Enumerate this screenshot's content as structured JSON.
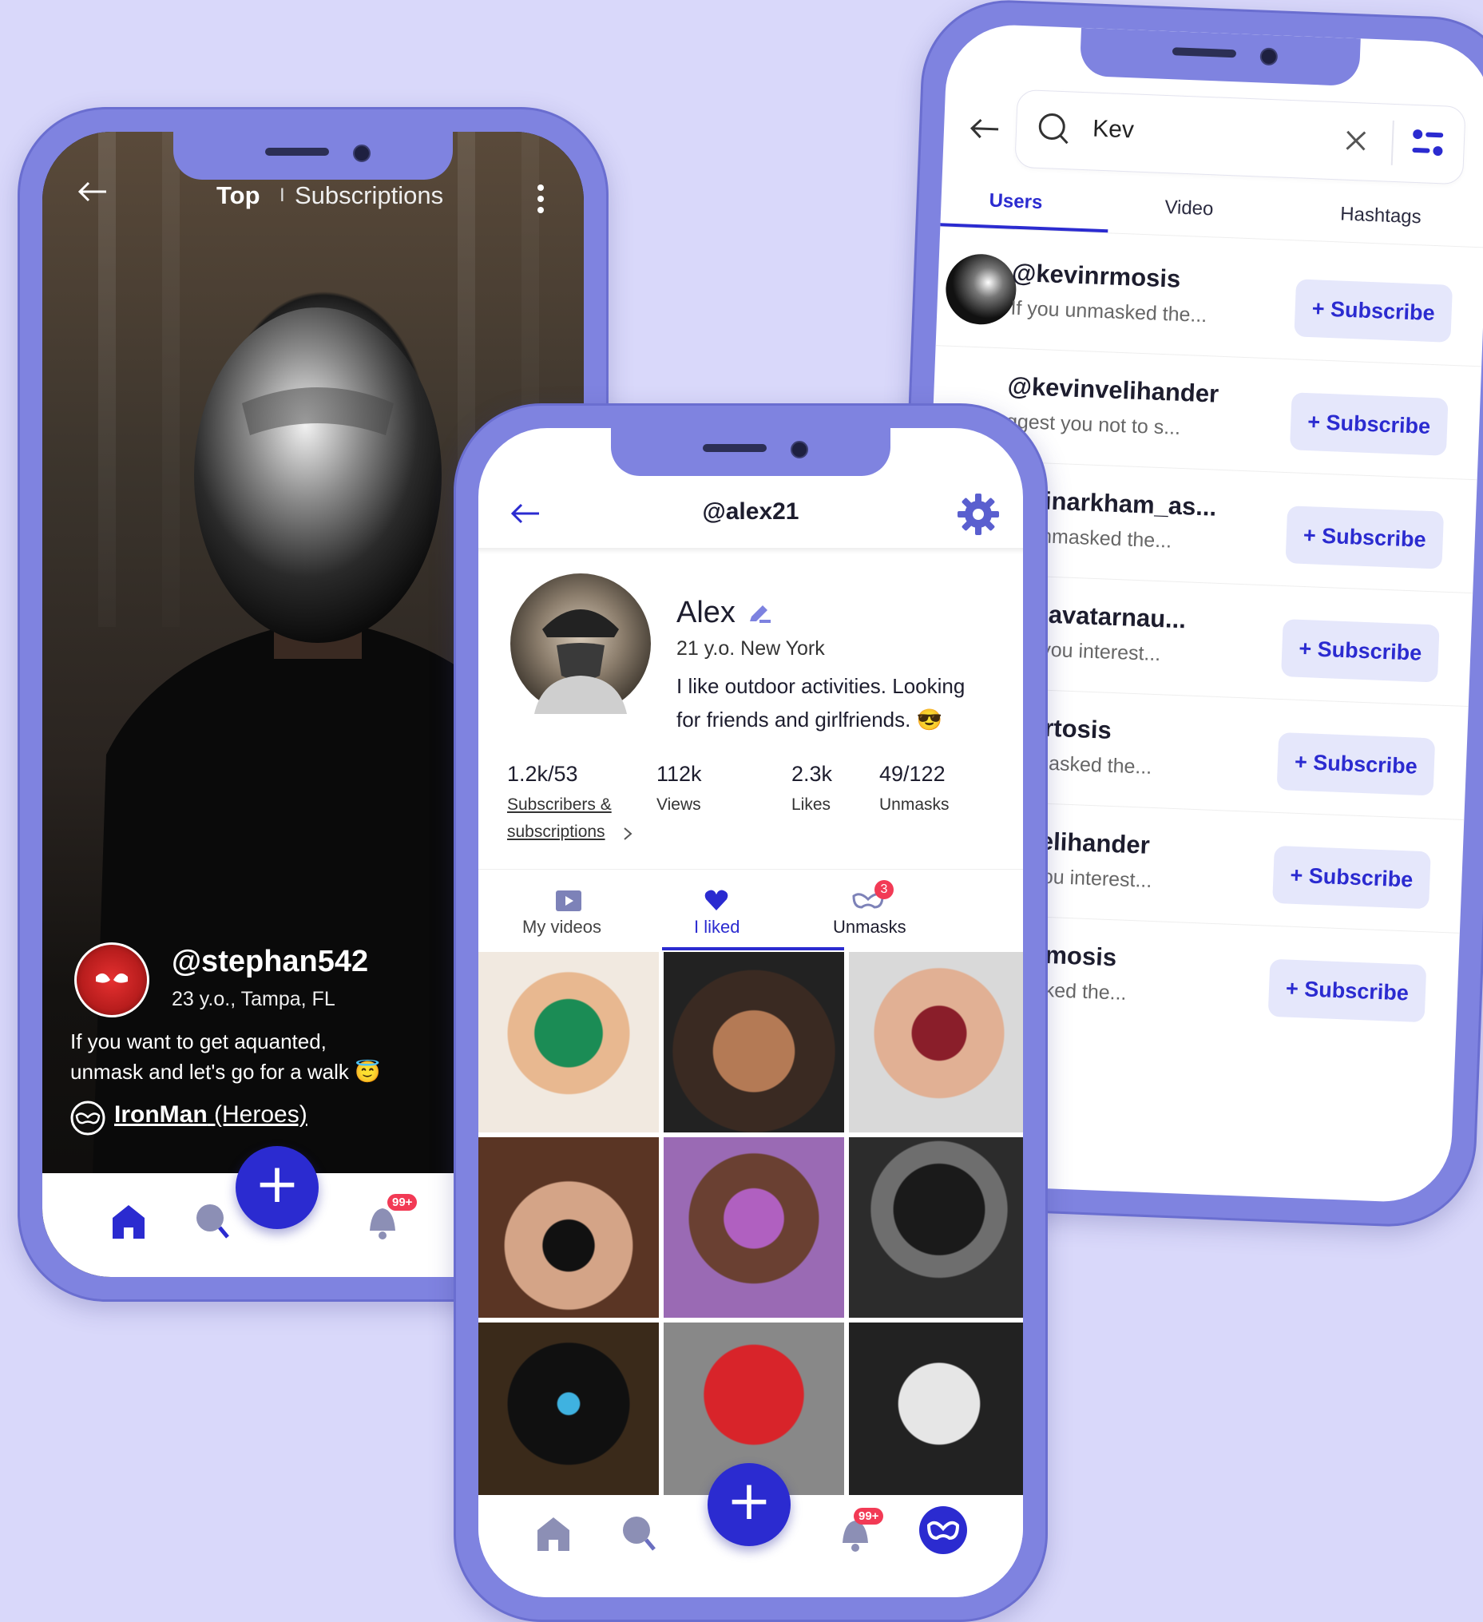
{
  "feed": {
    "tab_top": "Top",
    "tab_separator": "I",
    "tab_subscriptions": "Subscriptions",
    "username": "@stephan542",
    "meta": "23 y.o., Tampa, FL",
    "bio_line1": "If you want to get aquanted,",
    "bio_line2": "unmask and let's go for a walk 😇",
    "mask_name": "IronMan",
    "mask_category": "(Heroes)",
    "notif_badge": "99+",
    "icons": [
      "back-arrow-icon",
      "more-icon",
      "home-icon",
      "search-icon",
      "add-icon",
      "bell-icon",
      "mask-icon"
    ]
  },
  "search": {
    "query": "Kev",
    "tabs": [
      {
        "label": "Users",
        "active": true
      },
      {
        "label": "Video",
        "active": false
      },
      {
        "label": "Hashtags",
        "active": false
      }
    ],
    "subscribe_label": "+ Subscribe",
    "users": [
      {
        "handle": "@kevinrmosis",
        "bio": "If you unmasked the..."
      },
      {
        "handle": "@kevinvelihander",
        "bio": "ggest you not to s..."
      },
      {
        "handle": "kevinarkham_as...",
        "bio": "ou unmasked the..."
      },
      {
        "handle": "evinavatarnau...",
        "bio": "gest you interest..."
      },
      {
        "handle": "evinrtosis",
        "bio": "u unmasked the..."
      },
      {
        "handle": "vinvelihander",
        "bio": "gest you interest..."
      },
      {
        "handle": "vinarmosis",
        "bio": "unmasked the..."
      }
    ],
    "accent": "#2b2bd0"
  },
  "profile": {
    "title": "@alex21",
    "name": "Alex",
    "meta": "21 y.o. New York",
    "bio_line1": "I like outdoor activities. Looking",
    "bio_line2": "for friends and girlfriends. 😎",
    "stats": [
      {
        "value": "1.2k/53",
        "label_line1": "Subscribers &",
        "label_line2": "subscriptions"
      },
      {
        "value": "112k",
        "label_line1": "Views"
      },
      {
        "value": "2.3k",
        "label_line1": "Likes"
      },
      {
        "value": "49/122",
        "label_line1": "Unmasks"
      }
    ],
    "tabs": [
      {
        "label": "My videos",
        "active": false
      },
      {
        "label": "I liked",
        "active": true
      },
      {
        "label": "Unmasks",
        "active": false,
        "badge": "3"
      }
    ],
    "notif_badge": "99+",
    "brand_color": "#2b2bd0"
  }
}
